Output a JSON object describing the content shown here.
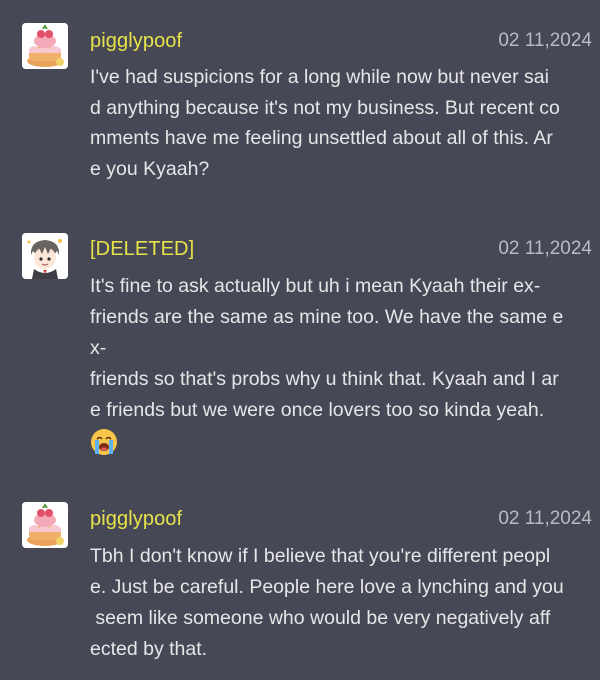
{
  "comments": [
    {
      "username": "pigglypoof",
      "timestamp": "02 11,2024",
      "avatar_icon": "cake-avatar-icon",
      "lines": [
        "I've had suspicions for a long while now but never sai",
        "d anything because it's not my business. But recent co",
        "mments have me feeling unsettled about all of this. Ar",
        "e you Kyaah?"
      ]
    },
    {
      "username": "[DELETED]",
      "timestamp": "02 11,2024",
      "avatar_icon": "anime-character-avatar-icon",
      "lines": [
        "It's fine to ask actually but uh i mean Kyaah their ex-",
        "friends are the same as mine too. We have the same e",
        "x-",
        "friends so that's probs why u think that. Kyaah and I ar",
        "e friends but we were once lovers too so kinda yeah."
      ],
      "emoji": "loudly-crying-face-emoji"
    },
    {
      "username": "pigglypoof",
      "timestamp": "02 11,2024",
      "avatar_icon": "cake-avatar-icon",
      "lines": [
        "Tbh I don't know if I believe that you're different peopl",
        "e. Just be careful. People here love a lynching and you",
        " seem like someone who would be very negatively aff",
        "ected by that."
      ]
    }
  ]
}
